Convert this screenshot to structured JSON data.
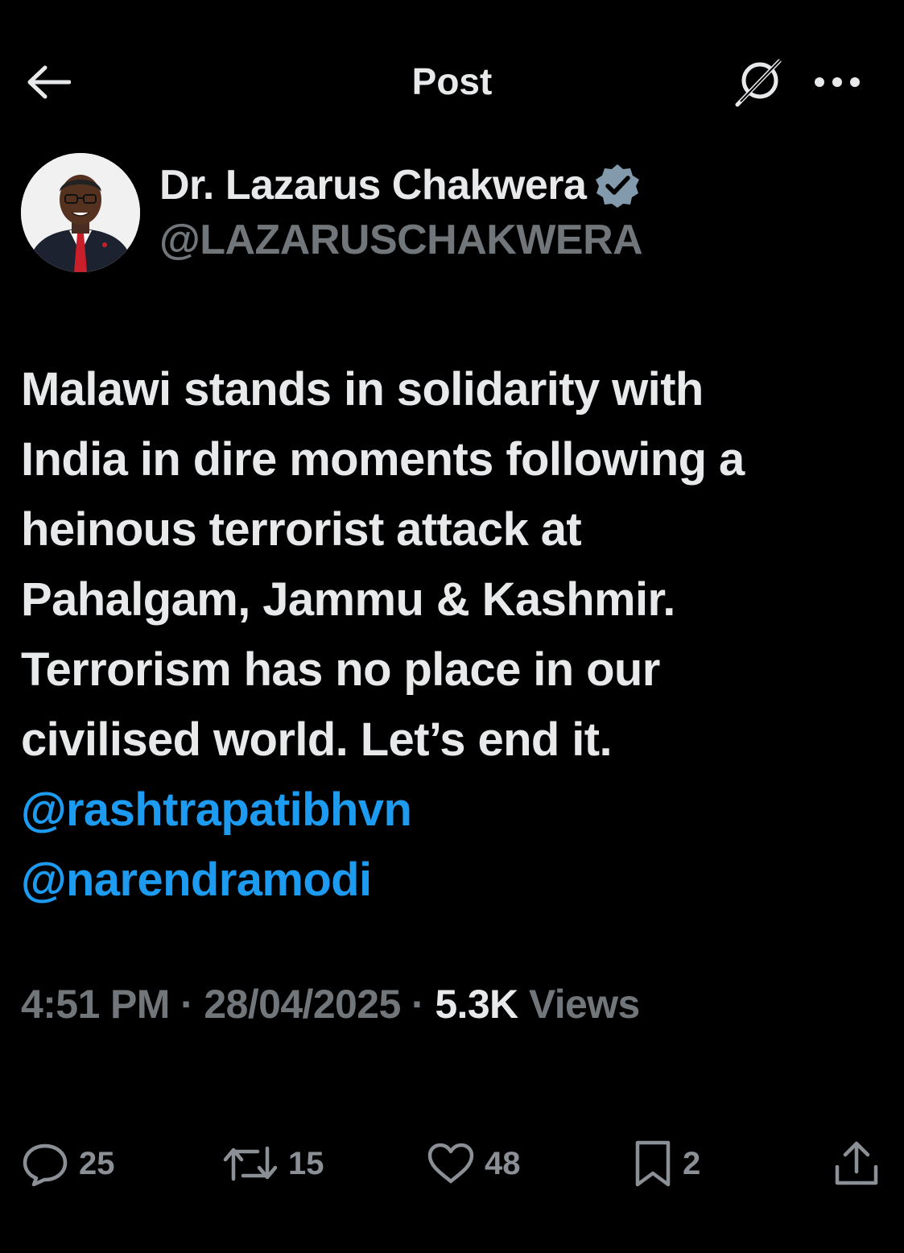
{
  "header": {
    "title": "Post"
  },
  "author": {
    "name": "Dr. Lazarus Chakwera",
    "handle": "@LAZARUSCHAKWERA",
    "verified": true
  },
  "post": {
    "lines": [
      "Malawi stands in solidarity with",
      "India in dire moments following a",
      "heinous terrorist attack at",
      "Pahalgam, Jammu & Kashmir.",
      "Terrorism has no place in our",
      "civilised world. Let’s end it."
    ],
    "mentions": [
      "@rashtrapatibhvn",
      "@narendramodi"
    ]
  },
  "meta": {
    "time": "4:51 PM",
    "separator": "·",
    "date": "28/04/2025",
    "views_count": "5.3K",
    "views_label": "Views"
  },
  "actions": {
    "replies": "25",
    "reposts": "15",
    "likes": "48",
    "bookmarks": "2"
  },
  "colors": {
    "background": "#000000",
    "text": "#e7e9ea",
    "secondary": "#71767b",
    "accent": "#1d9bf0",
    "verified": "#829aab"
  }
}
